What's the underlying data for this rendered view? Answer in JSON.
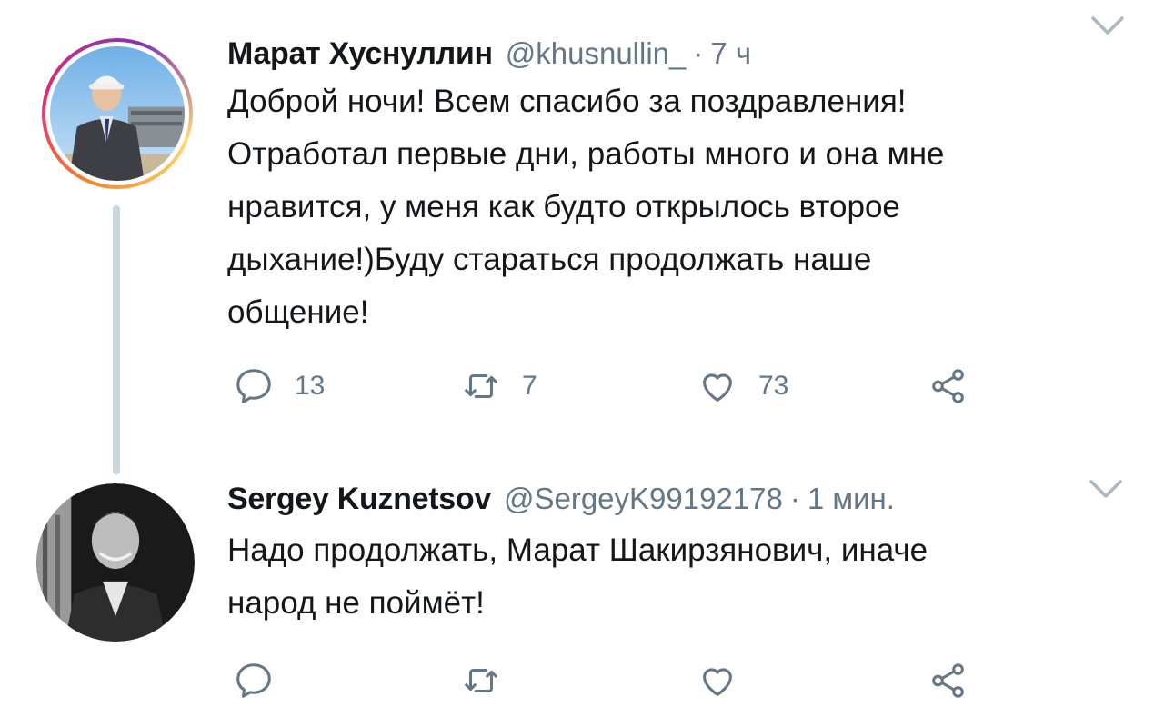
{
  "tweets": [
    {
      "display_name": "Марат Хуснуллин",
      "handle": "@khusnullin_",
      "time": "7 ч",
      "separator": "·",
      "text": "Доброй ночи! Всем спасибо за поздравления!\nОтработал первые дни, работы много и она мне\nнравится, у меня как будто открылось второе\nдыхание!)Буду стараться продолжать наше\nобщение!",
      "replies": "13",
      "retweets": "7",
      "likes": "73"
    },
    {
      "display_name": "Sergey Kuznetsov",
      "handle": "@SergeyK99192178",
      "time": "1 мин.",
      "separator": "·",
      "text": "Надо продолжать, Марат Шакирзянович, иначе\nнарод не поймёт!",
      "replies": "",
      "retweets": "",
      "likes": ""
    }
  ],
  "icons": {
    "reply": "reply-icon",
    "retweet": "retweet-icon",
    "like": "heart-icon",
    "share": "share-icon",
    "menu": "chevron-down-icon"
  },
  "colors": {
    "text": "#14171a",
    "secondary": "#657786",
    "thread_line": "#ccd6dd",
    "story_ring": "#dd2a7b"
  }
}
